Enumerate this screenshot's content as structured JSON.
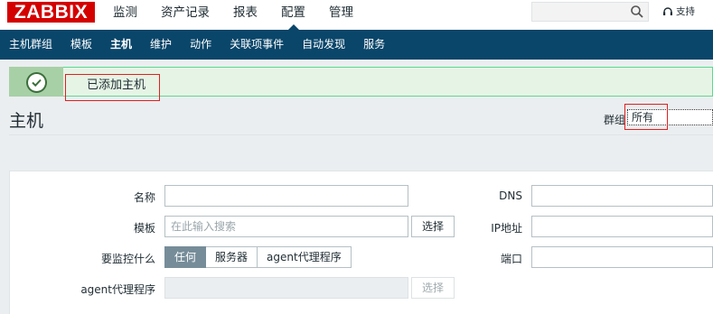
{
  "logo": "ZABBIX",
  "main_menu": [
    "监测",
    "资产记录",
    "报表",
    "配置",
    "管理"
  ],
  "main_menu_active": "配置",
  "search": {
    "value": ""
  },
  "support_label": "支持",
  "sub_menu": [
    "主机群组",
    "模板",
    "主机",
    "维护",
    "动作",
    "关联项事件",
    "自动发现",
    "服务"
  ],
  "sub_menu_active": "主机",
  "message": {
    "text": "已添加主机",
    "type": "success"
  },
  "page_title": "主机",
  "group_filter": {
    "label": "群组",
    "value": "所有"
  },
  "form": {
    "name": {
      "label": "名称",
      "value": ""
    },
    "templates": {
      "label": "模板",
      "placeholder": "在此输入搜索",
      "button": "选择"
    },
    "monitored_by": {
      "label": "要监控什么",
      "options": [
        "任何",
        "服务器",
        "agent代理程序"
      ],
      "selected": "任何"
    },
    "agent_proxy": {
      "label": "agent代理程序",
      "button": "选择"
    },
    "dns": {
      "label": "DNS",
      "value": ""
    },
    "ip": {
      "label": "IP地址",
      "value": ""
    },
    "port": {
      "label": "端口",
      "value": ""
    }
  },
  "colors": {
    "header_dark": "#0a466a",
    "logo_red": "#d40000",
    "success_green": "#59db8f",
    "segment_active": "#768d99",
    "highlight_box": "#e02020"
  }
}
